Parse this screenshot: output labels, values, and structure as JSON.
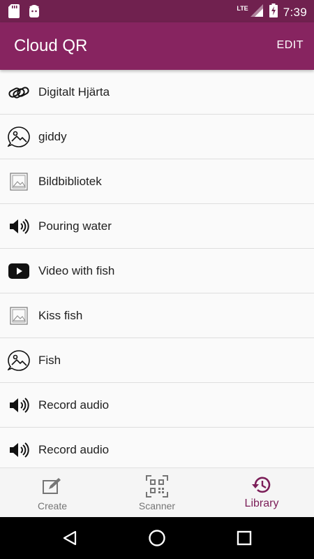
{
  "status_bar": {
    "time": "7:39",
    "network": "LTE",
    "left_icons": [
      "sd-card-icon",
      "android-icon"
    ],
    "right_icons": [
      "signal-icon",
      "battery-charging-icon"
    ]
  },
  "app_bar": {
    "title": "Cloud QR",
    "edit_label": "EDIT",
    "color": "#872460"
  },
  "library": {
    "items": [
      {
        "label": "Digitalt Hjärta",
        "icon": "link-icon"
      },
      {
        "label": "giddy",
        "icon": "image-chat-icon"
      },
      {
        "label": "Bildbibliotek",
        "icon": "image-icon"
      },
      {
        "label": "Pouring water",
        "icon": "audio-icon"
      },
      {
        "label": "Video with fish",
        "icon": "video-icon"
      },
      {
        "label": "Kiss fish",
        "icon": "image-icon"
      },
      {
        "label": "Fish",
        "icon": "image-chat-icon"
      },
      {
        "label": "Record audio",
        "icon": "audio-icon"
      },
      {
        "label": "Record audio",
        "icon": "audio-icon"
      }
    ]
  },
  "bottom_nav": {
    "tabs": [
      {
        "label": "Create",
        "icon": "edit-icon"
      },
      {
        "label": "Scanner",
        "icon": "qr-scan-icon"
      },
      {
        "label": "Library",
        "icon": "history-icon",
        "active": true
      }
    ],
    "active_color": "#7b1e58"
  },
  "system_nav": {
    "buttons": [
      "back-icon",
      "home-icon",
      "recents-icon"
    ]
  }
}
